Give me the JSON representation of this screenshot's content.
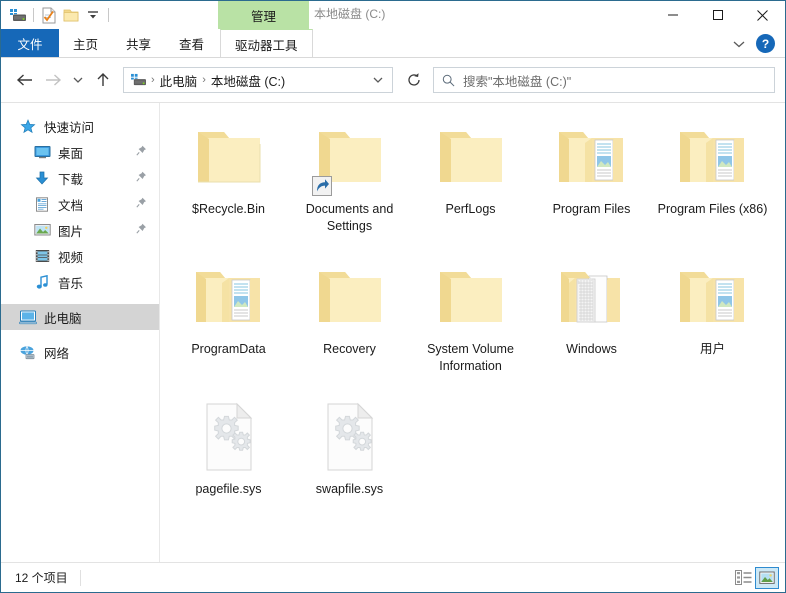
{
  "window": {
    "title": "本地磁盘 (C:)",
    "accent_blue": "#1668b8",
    "border_color": "#2b6b8f",
    "context_tab_header_color": "#b9e2a5"
  },
  "quick_access_toolbar": {
    "items": [
      {
        "name": "drive-icon",
        "label": ""
      },
      {
        "name": "properties-icon",
        "label": ""
      },
      {
        "name": "new-folder-icon",
        "label": ""
      },
      {
        "name": "customize-chevron-icon",
        "label": ""
      }
    ]
  },
  "caption": {
    "minimize": "—",
    "maximize": "□",
    "close": "✕"
  },
  "ribbon": {
    "contextual_header": "管理",
    "tabs": [
      {
        "label": "文件",
        "state": "file"
      },
      {
        "label": "主页",
        "state": "normal"
      },
      {
        "label": "共享",
        "state": "normal"
      },
      {
        "label": "查看",
        "state": "normal"
      },
      {
        "label": "驱动器工具",
        "state": "contextual-active"
      }
    ],
    "collapse_icon": "chevron-down-icon",
    "help_label": "?"
  },
  "address": {
    "back_icon": "arrow-left-icon",
    "forward_icon": "arrow-right-icon",
    "recent_icon": "chevron-down-icon",
    "up_icon": "arrow-up-icon",
    "crumb_icon": "drive-icon",
    "crumbs": [
      "此电脑",
      "本地磁盘 (C:)"
    ],
    "separator": "›",
    "dropdown_icon": "chevron-down-icon",
    "refresh_icon": "refresh-icon"
  },
  "search": {
    "icon": "search-icon",
    "placeholder": "搜索\"本地磁盘 (C:)\""
  },
  "sidebar": {
    "items": [
      {
        "label": "快速访问",
        "icon": "star-icon",
        "level": "root",
        "pinned": false,
        "selected": false
      },
      {
        "label": "桌面",
        "icon": "desktop-icon",
        "level": "child",
        "pinned": true,
        "selected": false
      },
      {
        "label": "下载",
        "icon": "download-icon",
        "level": "child",
        "pinned": true,
        "selected": false
      },
      {
        "label": "文档",
        "icon": "documents-icon",
        "level": "child",
        "pinned": true,
        "selected": false
      },
      {
        "label": "图片",
        "icon": "pictures-icon",
        "level": "child",
        "pinned": true,
        "selected": false
      },
      {
        "label": "视频",
        "icon": "videos-icon",
        "level": "child",
        "pinned": false,
        "selected": false
      },
      {
        "label": "音乐",
        "icon": "music-icon",
        "level": "child",
        "pinned": false,
        "selected": false
      },
      {
        "label": "此电脑",
        "icon": "this-pc-icon",
        "level": "root",
        "pinned": false,
        "selected": true
      },
      {
        "label": "网络",
        "icon": "network-icon",
        "level": "root",
        "pinned": false,
        "selected": false
      }
    ]
  },
  "files": {
    "items": [
      {
        "label": "$Recycle.Bin",
        "icon": "folder-plain-icon"
      },
      {
        "label": "Documents and Settings",
        "icon": "folder-shortcut-icon"
      },
      {
        "label": "PerfLogs",
        "icon": "folder-plain-icon"
      },
      {
        "label": "Program Files",
        "icon": "folder-full-icon"
      },
      {
        "label": "Program Files (x86)",
        "icon": "folder-full-icon"
      },
      {
        "label": "ProgramData",
        "icon": "folder-full-icon"
      },
      {
        "label": "Recovery",
        "icon": "folder-plain-icon"
      },
      {
        "label": "System Volume Information",
        "icon": "folder-plain-icon"
      },
      {
        "label": "Windows",
        "icon": "folder-papers-icon"
      },
      {
        "label": "用户",
        "icon": "folder-full-icon"
      },
      {
        "label": "pagefile.sys",
        "icon": "system-file-icon"
      },
      {
        "label": "swapfile.sys",
        "icon": "system-file-icon"
      }
    ]
  },
  "statusbar": {
    "item_count": "12 个项目",
    "views": [
      {
        "name": "details-view-button",
        "active": false
      },
      {
        "name": "large-icons-view-button",
        "active": true
      }
    ]
  }
}
